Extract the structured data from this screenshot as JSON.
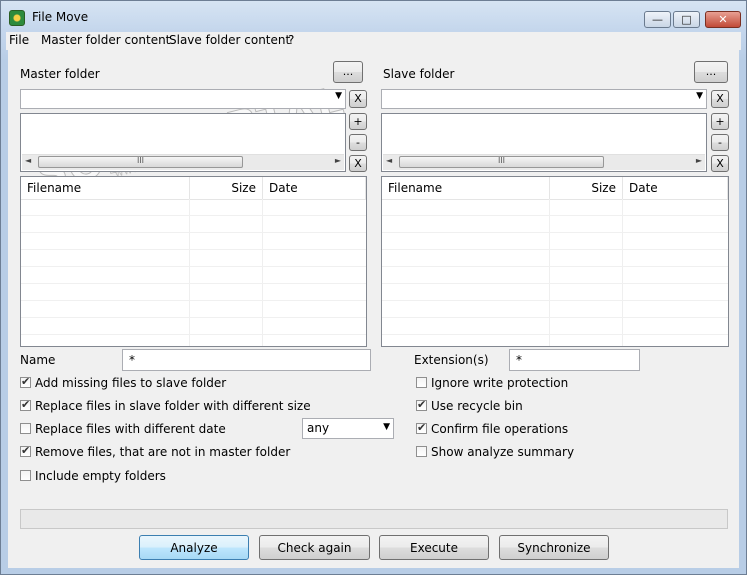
{
  "window": {
    "title": "File Move",
    "minimize_glyph": "—",
    "maximize_glyph": "□",
    "close_glyph": "✕"
  },
  "menu": [
    "File",
    "Master folder content",
    "Slave folder content",
    "?"
  ],
  "master": {
    "label": "Master folder",
    "browse_label": "...",
    "clear_label": "X",
    "plus_label": "+",
    "minus_label": "-",
    "remove_label": "X",
    "columns": [
      "Filename",
      "Size",
      "Date"
    ]
  },
  "slave": {
    "label": "Slave folder",
    "browse_label": "...",
    "clear_label": "X",
    "plus_label": "+",
    "minus_label": "-",
    "remove_label": "X",
    "columns": [
      "Filename",
      "Size",
      "Date"
    ]
  },
  "scroll_grip": "III",
  "scroll_left": "◄",
  "scroll_right": "►",
  "filters": {
    "name_label": "Name",
    "name_value": "*",
    "ext_label": "Extension(s)",
    "ext_value": "*"
  },
  "options_left": [
    {
      "label": "Add missing files to slave folder",
      "checked": true
    },
    {
      "label": "Replace files in slave folder with different size",
      "checked": true
    },
    {
      "label": "Replace files with different date",
      "checked": false
    },
    {
      "label": "Remove files, that are not in master folder",
      "checked": true
    },
    {
      "label": "Include empty folders",
      "checked": false
    }
  ],
  "date_combo": {
    "value": "any"
  },
  "options_right": [
    {
      "label": "Ignore write protection",
      "checked": false
    },
    {
      "label": "Use recycle bin",
      "checked": true
    },
    {
      "label": "Confirm file operations",
      "checked": true
    },
    {
      "label": "Show analyze summary",
      "checked": false
    }
  ],
  "buttons": {
    "analyze": "Analyze",
    "check_again": "Check again",
    "execute": "Execute",
    "synchronize": "Synchronize"
  },
  "watermark": {
    "text": "SOFTPORTAL",
    "sub": "www.softportal.com"
  }
}
